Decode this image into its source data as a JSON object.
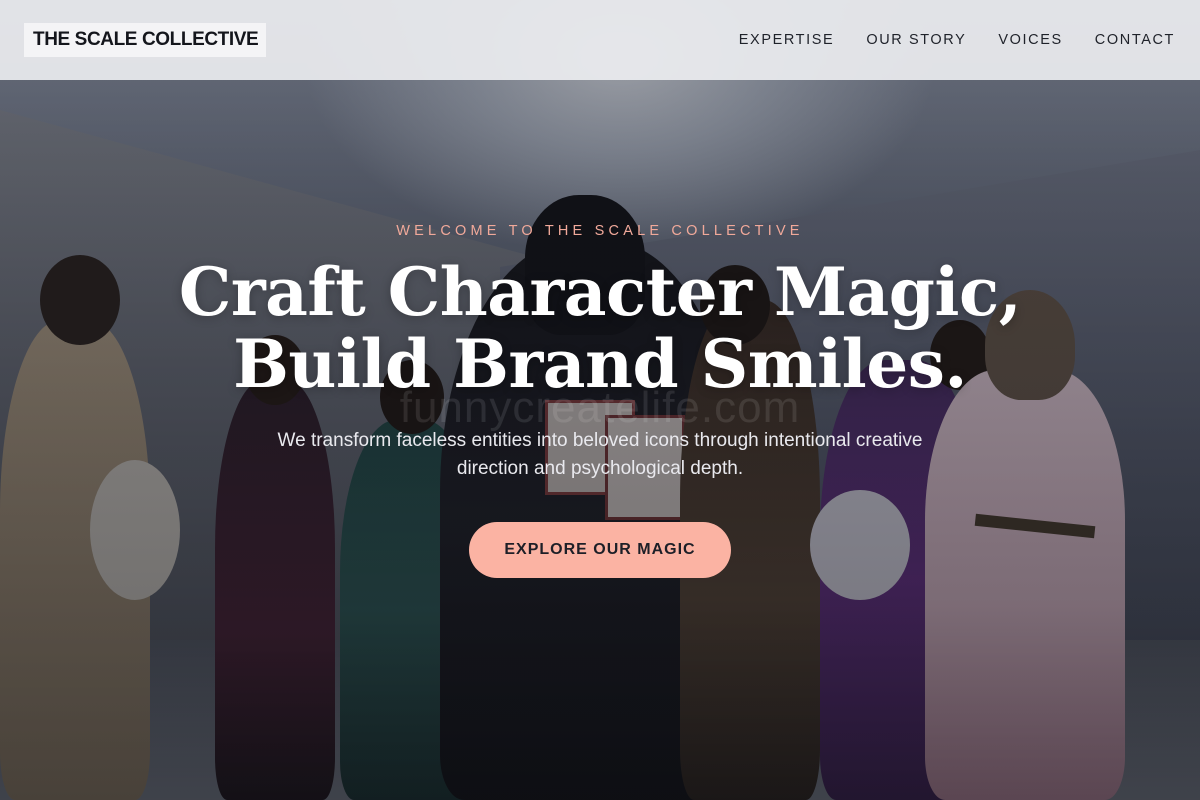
{
  "header": {
    "logo": "THE SCALE COLLECTIVE",
    "nav": [
      {
        "label": "EXPERTISE"
      },
      {
        "label": "OUR STORY"
      },
      {
        "label": "VOICES"
      },
      {
        "label": "CONTACT"
      }
    ]
  },
  "hero": {
    "eyebrow": "WELCOME TO THE SCALE COLLECTIVE",
    "headline_line1": "Craft Character Magic,",
    "headline_line2": "Build Brand Smiles.",
    "watermark": "funnycreatelife.com",
    "subhead": "We transform faceless entities into beloved icons through intentional creative direction and psychological depth.",
    "cta_label": "EXPLORE OUR MAGIC"
  },
  "colors": {
    "accent": "#fbb3a3",
    "eyebrow": "#f1a99a",
    "header_bg": "#ecedf0",
    "text_dark": "#14161c"
  }
}
